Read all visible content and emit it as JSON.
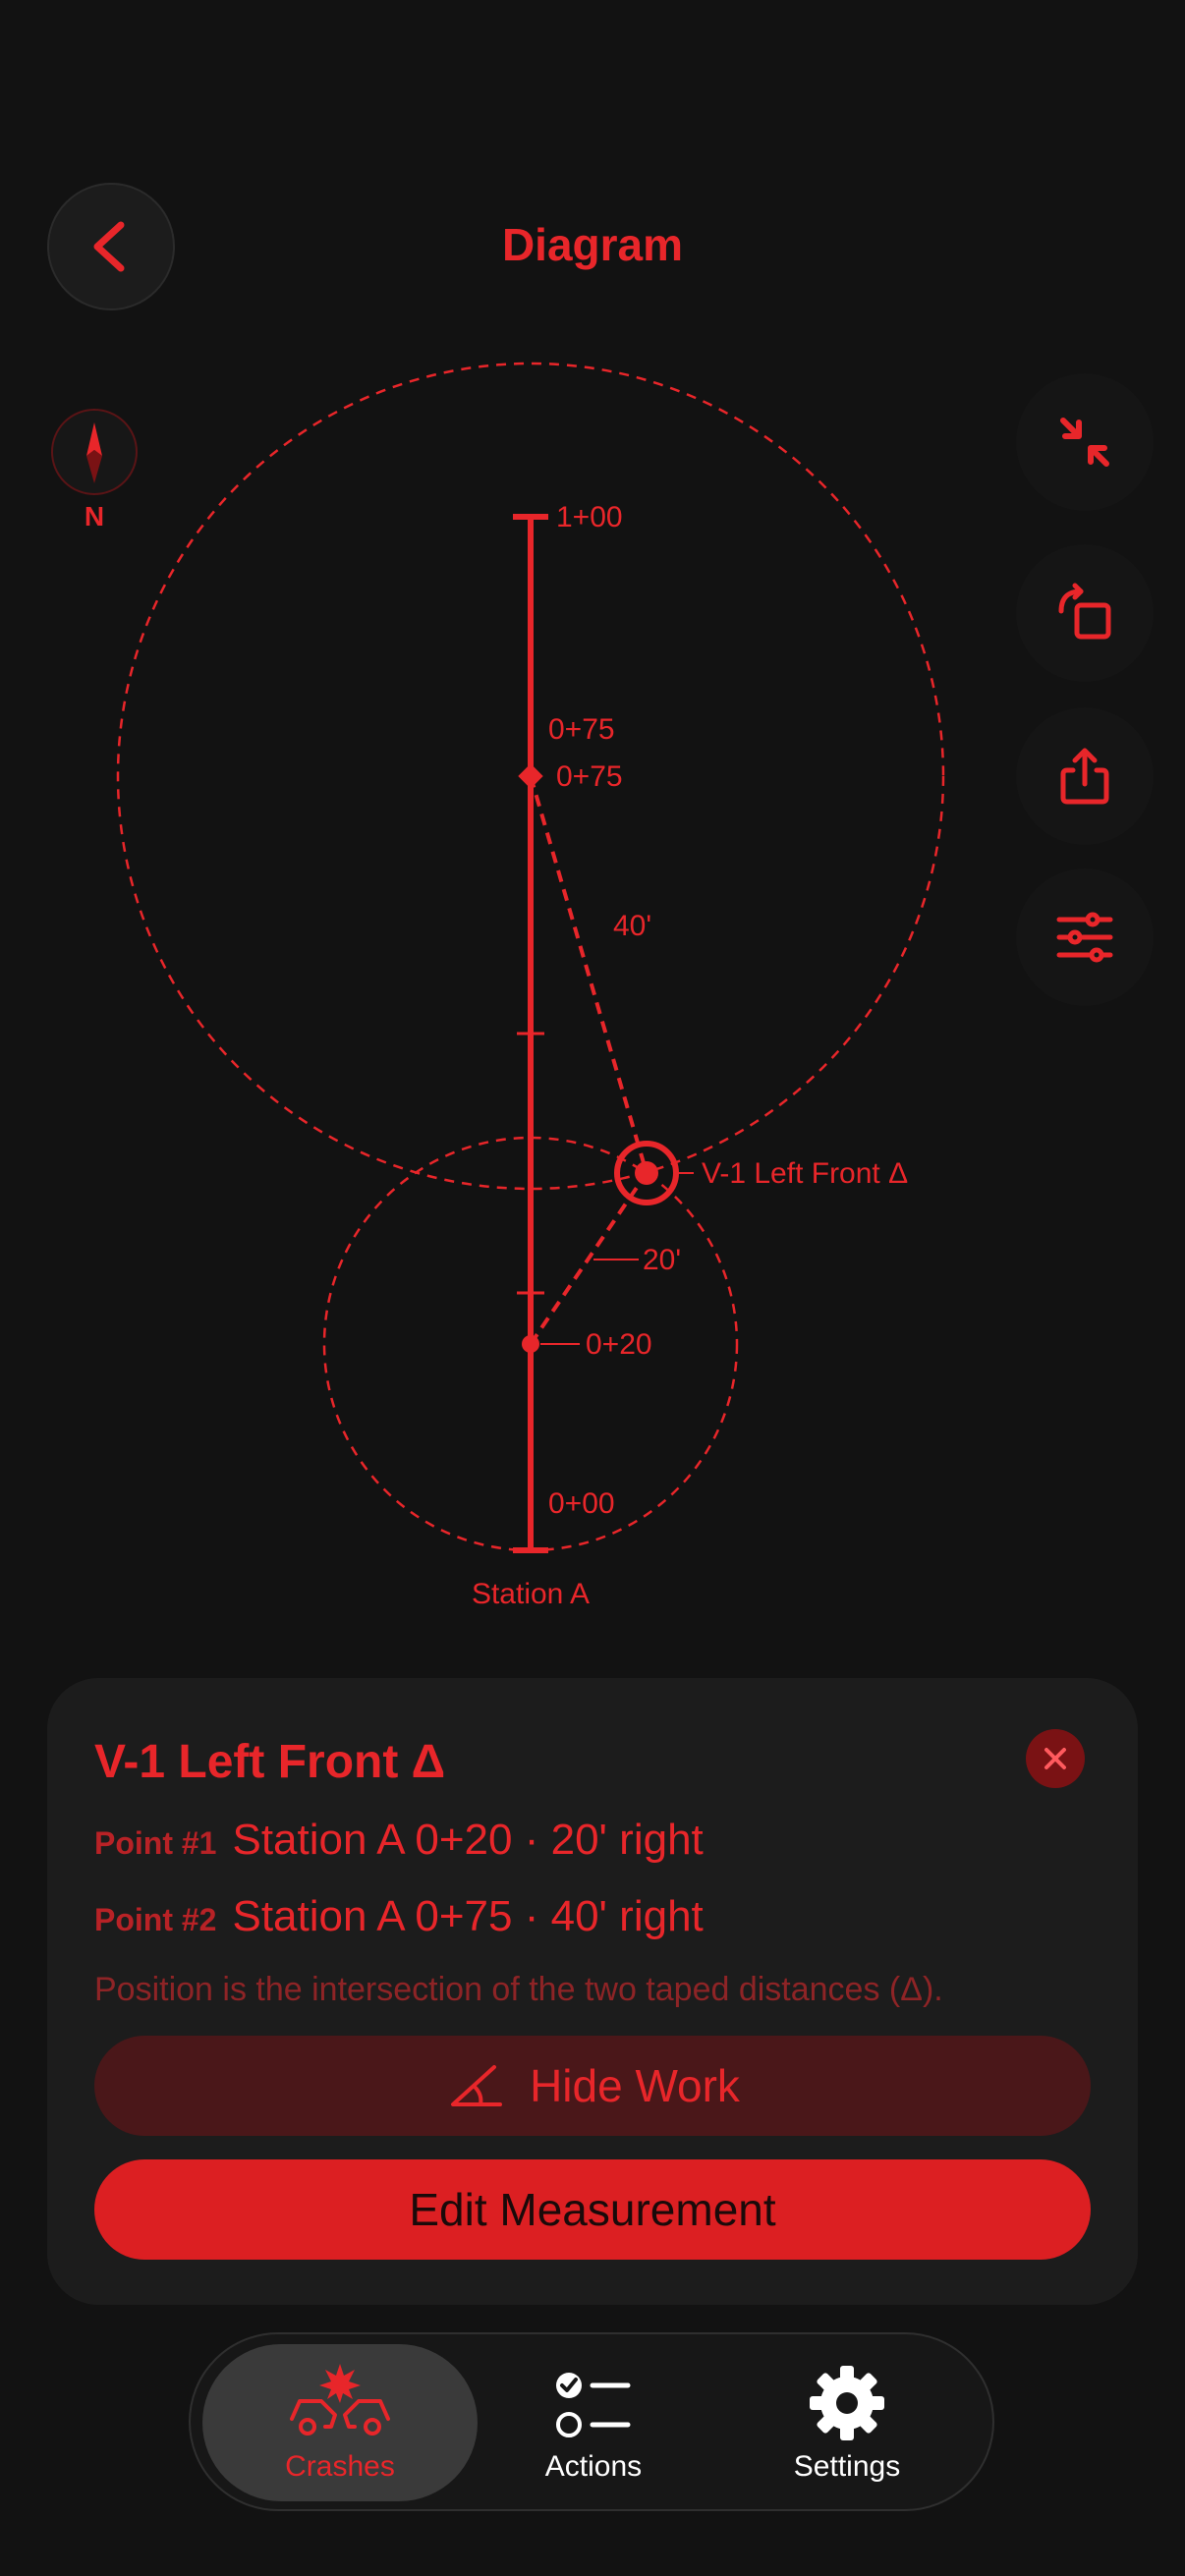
{
  "header": {
    "title": "Diagram",
    "back_icon": "chevron-left-icon"
  },
  "compass": {
    "label": "N"
  },
  "toolbar": [
    {
      "icon": "collapse-arrows-icon"
    },
    {
      "icon": "rotate-icon"
    },
    {
      "icon": "share-icon"
    },
    {
      "icon": "sliders-icon"
    }
  ],
  "diagram": {
    "baseline_name": "Station A",
    "stations": {
      "top": "1+00",
      "upper_callout": "0+75",
      "upper_point": "0+75",
      "lower_point": "0+20",
      "bottom": "0+00"
    },
    "distances": {
      "upper": "40'",
      "lower": "20'"
    },
    "target_label": "V-1 Left Front Δ"
  },
  "detail": {
    "title": "V-1 Left Front Δ",
    "points": [
      {
        "label": "Point #1",
        "value": "Station A 0+20 · 20' right"
      },
      {
        "label": "Point #2",
        "value": "Station A 0+75 · 40' right"
      }
    ],
    "explanation": "Position is the intersection of the two taped distances (Δ).",
    "hide_work_label": "Hide Work",
    "edit_label": "Edit Measurement"
  },
  "tabs": [
    {
      "label": "Crashes",
      "icon": "crash-icon",
      "active": true
    },
    {
      "label": "Actions",
      "icon": "checklist-icon",
      "active": false
    },
    {
      "label": "Settings",
      "icon": "gear-icon",
      "active": false
    }
  ],
  "colors": {
    "accent": "#e8262a",
    "background": "#121212",
    "card": "#1c1c1c"
  }
}
